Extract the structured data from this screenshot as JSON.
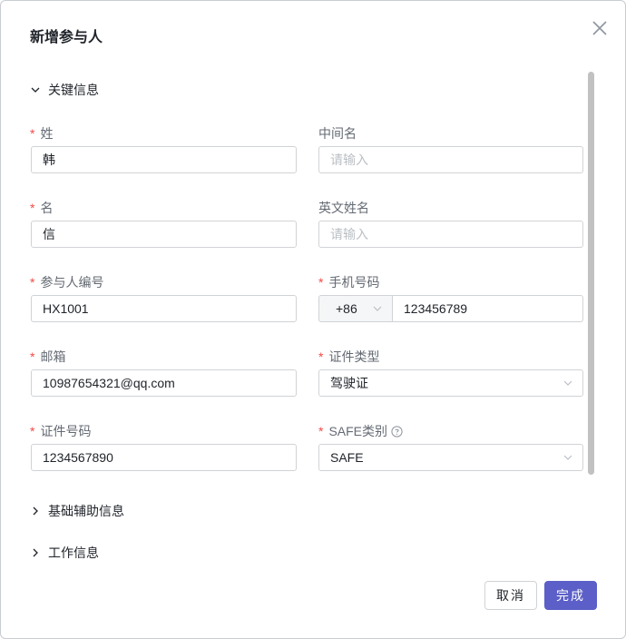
{
  "dialog": {
    "title": "新增参与人",
    "cancel_label": "取消",
    "ok_label": "完成"
  },
  "sections": {
    "key_info": "关键信息",
    "basic_aux": "基础辅助信息",
    "work_info": "工作信息"
  },
  "fields": {
    "last_name": {
      "label": "姓",
      "value": "韩"
    },
    "middle_name": {
      "label": "中间名",
      "placeholder": "请输入"
    },
    "first_name": {
      "label": "名",
      "value": "信"
    },
    "english_name": {
      "label": "英文姓名",
      "placeholder": "请输入"
    },
    "participant_id": {
      "label": "参与人编号",
      "value": "HX1001"
    },
    "phone": {
      "label": "手机号码",
      "prefix": "+86",
      "value": "123456789"
    },
    "email": {
      "label": "邮箱",
      "value": "10987654321@qq.com"
    },
    "id_type": {
      "label": "证件类型",
      "value": "驾驶证"
    },
    "id_number": {
      "label": "证件号码",
      "value": "1234567890"
    },
    "safe_category": {
      "label": "SAFE类别",
      "value": "SAFE"
    }
  },
  "icons": {
    "close": "close-icon",
    "expanded": "chevron-down-icon",
    "collapsed": "chevron-right-icon",
    "help": "question-circle-icon"
  },
  "colors": {
    "primary": "#5b5fc7",
    "required": "#f54a45"
  }
}
